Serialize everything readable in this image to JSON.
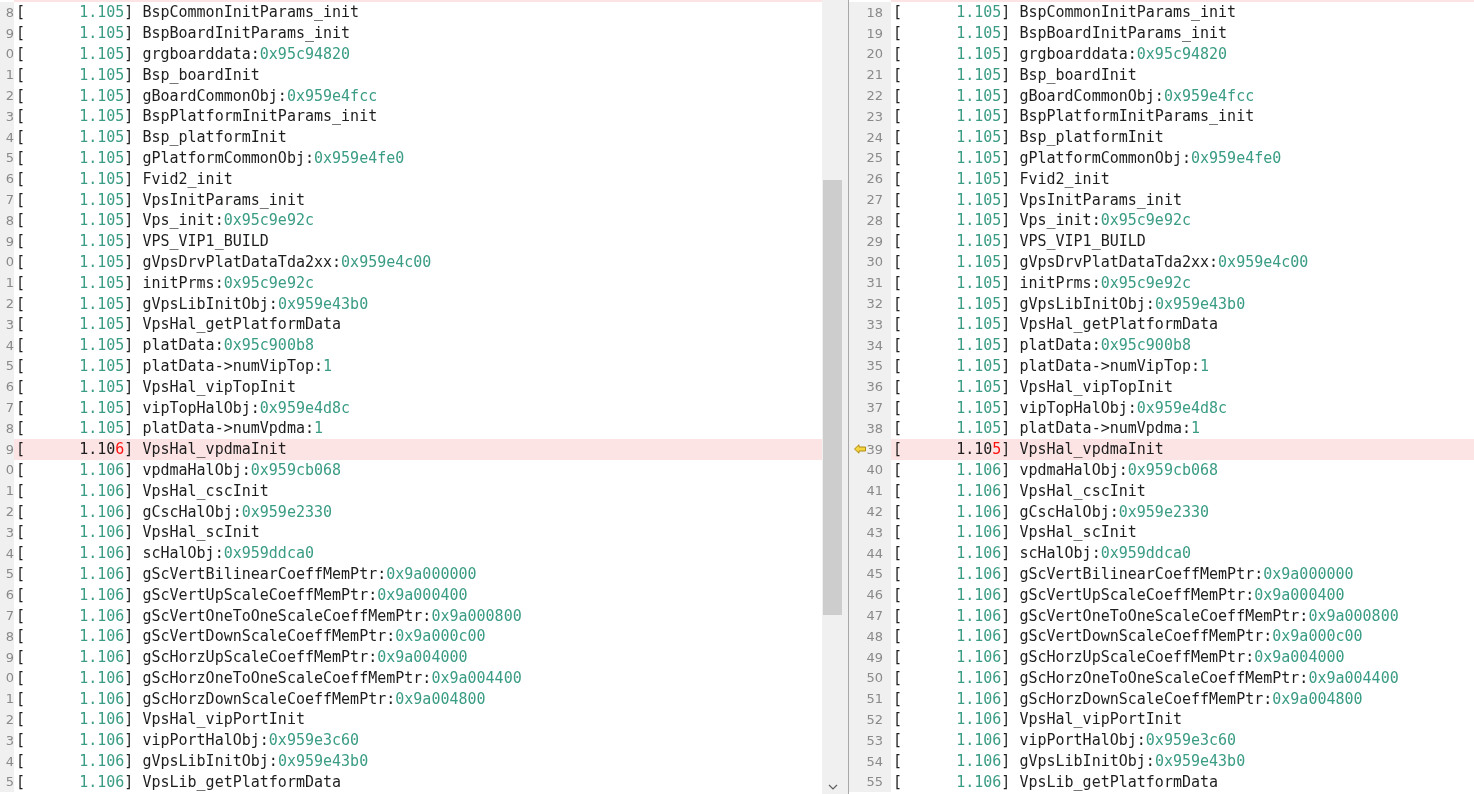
{
  "panes": [
    {
      "kind": "left",
      "above_diff": true,
      "rows": [
        {
          "num": "8",
          "open": "[",
          "time": "1.105",
          "close": "]",
          "text": "BspCommonInitParams_init",
          "diff": false
        },
        {
          "num": "9",
          "open": "[",
          "time": "1.105",
          "close": "]",
          "text": "BspBoardInitParams_init",
          "diff": false
        },
        {
          "num": "0",
          "open": "[",
          "time": "1.105",
          "close": "]",
          "text": "grgboarddata:",
          "value": "0x95c94820",
          "diff": false
        },
        {
          "num": "1",
          "open": "[",
          "time": "1.105",
          "close": "]",
          "text": "Bsp_boardInit",
          "diff": false
        },
        {
          "num": "2",
          "open": "[",
          "time": "1.105",
          "close": "]",
          "text": "gBoardCommonObj:",
          "value": "0x959e4fcc",
          "diff": false
        },
        {
          "num": "3",
          "open": "[",
          "time": "1.105",
          "close": "]",
          "text": "BspPlatformInitParams_init",
          "diff": false
        },
        {
          "num": "4",
          "open": "[",
          "time": "1.105",
          "close": "]",
          "text": "Bsp_platformInit",
          "diff": false
        },
        {
          "num": "5",
          "open": "[",
          "time": "1.105",
          "close": "]",
          "text": "gPlatformCommonObj:",
          "value": "0x959e4fe0",
          "diff": false
        },
        {
          "num": "6",
          "open": "[",
          "time": "1.105",
          "close": "]",
          "text": "Fvid2_init",
          "diff": false
        },
        {
          "num": "7",
          "open": "[",
          "time": "1.105",
          "close": "]",
          "text": "VpsInitParams_init",
          "diff": false
        },
        {
          "num": "8",
          "open": "[",
          "time": "1.105",
          "close": "]",
          "text": "Vps_init:",
          "value": "0x95c9e92c",
          "diff": false
        },
        {
          "num": "9",
          "open": "[",
          "time": "1.105",
          "close": "]",
          "text": "VPS_VIP1_BUILD",
          "diff": false
        },
        {
          "num": "0",
          "open": "[",
          "time": "1.105",
          "close": "]",
          "text": "gVpsDrvPlatDataTda2xx:",
          "value": "0x959e4c00",
          "diff": false
        },
        {
          "num": "1",
          "open": "[",
          "time": "1.105",
          "close": "]",
          "text": "initPrms:",
          "value": "0x95c9e92c",
          "diff": false
        },
        {
          "num": "2",
          "open": "[",
          "time": "1.105",
          "close": "]",
          "text": "gVpsLibInitObj:",
          "value": "0x959e43b0",
          "diff": false
        },
        {
          "num": "3",
          "open": "[",
          "time": "1.105",
          "close": "]",
          "text": "VpsHal_getPlatformData",
          "diff": false
        },
        {
          "num": "4",
          "open": "[",
          "time": "1.105",
          "close": "]",
          "text": "platData:",
          "value": "0x95c900b8",
          "diff": false
        },
        {
          "num": "5",
          "open": "[",
          "time": "1.105",
          "close": "]",
          "text": "platData->numVipTop:",
          "value": "1",
          "diff": false
        },
        {
          "num": "6",
          "open": "[",
          "time": "1.105",
          "close": "]",
          "text": "VpsHal_vipTopInit",
          "diff": false
        },
        {
          "num": "7",
          "open": "[",
          "time": "1.105",
          "close": "]",
          "text": "vipTopHalObj:",
          "value": "0x959e4d8c",
          "diff": false
        },
        {
          "num": "8",
          "open": "[",
          "time": "1.105",
          "close": "]",
          "text": "platData->numVpdma:",
          "value": "1",
          "diff": false
        },
        {
          "num": "9",
          "open": "[",
          "time": "1.10",
          "diff_char": "6",
          "close": "]",
          "text": "VpsHal_vpdmaInit",
          "diff": true
        },
        {
          "num": "0",
          "open": "[",
          "time": "1.106",
          "close": "]",
          "text": "vpdmaHalObj:",
          "value": "0x959cb068",
          "diff": false
        },
        {
          "num": "1",
          "open": "[",
          "time": "1.106",
          "close": "]",
          "text": "VpsHal_cscInit",
          "diff": false
        },
        {
          "num": "2",
          "open": "[",
          "time": "1.106",
          "close": "]",
          "text": "gCscHalObj:",
          "value": "0x959e2330",
          "diff": false
        },
        {
          "num": "3",
          "open": "[",
          "time": "1.106",
          "close": "]",
          "text": "VpsHal_scInit",
          "diff": false
        },
        {
          "num": "4",
          "open": "[",
          "time": "1.106",
          "close": "]",
          "text": "scHalObj:",
          "value": "0x959ddca0",
          "diff": false
        },
        {
          "num": "5",
          "open": "[",
          "time": "1.106",
          "close": "]",
          "text": "gScVertBilinearCoeffMemPtr:",
          "value": "0x9a000000",
          "diff": false
        },
        {
          "num": "6",
          "open": "[",
          "time": "1.106",
          "close": "]",
          "text": "gScVertUpScaleCoeffMemPtr:",
          "value": "0x9a000400",
          "diff": false
        },
        {
          "num": "7",
          "open": "[",
          "time": "1.106",
          "close": "]",
          "text": "gScVertOneToOneScaleCoeffMemPtr:",
          "value": "0x9a000800",
          "diff": false
        },
        {
          "num": "8",
          "open": "[",
          "time": "1.106",
          "close": "]",
          "text": "gScVertDownScaleCoeffMemPtr:",
          "value": "0x9a000c00",
          "diff": false
        },
        {
          "num": "9",
          "open": "[",
          "time": "1.106",
          "close": "]",
          "text": "gScHorzUpScaleCoeffMemPtr:",
          "value": "0x9a004000",
          "diff": false
        },
        {
          "num": "0",
          "open": "[",
          "time": "1.106",
          "close": "]",
          "text": "gScHorzOneToOneScaleCoeffMemPtr:",
          "value": "0x9a004400",
          "diff": false
        },
        {
          "num": "1",
          "open": "[",
          "time": "1.106",
          "close": "]",
          "text": "gScHorzDownScaleCoeffMemPtr:",
          "value": "0x9a004800",
          "diff": false
        },
        {
          "num": "2",
          "open": "[",
          "time": "1.106",
          "close": "]",
          "text": "VpsHal_vipPortInit",
          "diff": false
        },
        {
          "num": "3",
          "open": "[",
          "time": "1.106",
          "close": "]",
          "text": "vipPortHalObj:",
          "value": "0x959e3c60",
          "diff": false
        },
        {
          "num": "4",
          "open": "[",
          "time": "1.106",
          "close": "]",
          "text": "gVpsLibInitObj:",
          "value": "0x959e43b0",
          "diff": false
        },
        {
          "num": "5",
          "open": "[",
          "time": "1.106",
          "close": "]",
          "text": "VpsLib_getPlatformData",
          "diff": false
        }
      ]
    },
    {
      "kind": "right",
      "above_diff": true,
      "rows": [
        {
          "num": "18",
          "open": "[",
          "time": "1.105",
          "close": "]",
          "text": "BspCommonInitParams_init",
          "diff": false,
          "marker": false
        },
        {
          "num": "19",
          "open": "[",
          "time": "1.105",
          "close": "]",
          "text": "BspBoardInitParams_init",
          "diff": false,
          "marker": false
        },
        {
          "num": "20",
          "open": "[",
          "time": "1.105",
          "close": "]",
          "text": "grgboarddata:",
          "value": "0x95c94820",
          "diff": false,
          "marker": false
        },
        {
          "num": "21",
          "open": "[",
          "time": "1.105",
          "close": "]",
          "text": "Bsp_boardInit",
          "diff": false,
          "marker": false
        },
        {
          "num": "22",
          "open": "[",
          "time": "1.105",
          "close": "]",
          "text": "gBoardCommonObj:",
          "value": "0x959e4fcc",
          "diff": false,
          "marker": false
        },
        {
          "num": "23",
          "open": "[",
          "time": "1.105",
          "close": "]",
          "text": "BspPlatformInitParams_init",
          "diff": false,
          "marker": false
        },
        {
          "num": "24",
          "open": "[",
          "time": "1.105",
          "close": "]",
          "text": "Bsp_platformInit",
          "diff": false,
          "marker": false
        },
        {
          "num": "25",
          "open": "[",
          "time": "1.105",
          "close": "]",
          "text": "gPlatformCommonObj:",
          "value": "0x959e4fe0",
          "diff": false,
          "marker": false
        },
        {
          "num": "26",
          "open": "[",
          "time": "1.105",
          "close": "]",
          "text": "Fvid2_init",
          "diff": false,
          "marker": false
        },
        {
          "num": "27",
          "open": "[",
          "time": "1.105",
          "close": "]",
          "text": "VpsInitParams_init",
          "diff": false,
          "marker": false
        },
        {
          "num": "28",
          "open": "[",
          "time": "1.105",
          "close": "]",
          "text": "Vps_init:",
          "value": "0x95c9e92c",
          "diff": false,
          "marker": false
        },
        {
          "num": "29",
          "open": "[",
          "time": "1.105",
          "close": "]",
          "text": "VPS_VIP1_BUILD",
          "diff": false,
          "marker": false
        },
        {
          "num": "30",
          "open": "[",
          "time": "1.105",
          "close": "]",
          "text": "gVpsDrvPlatDataTda2xx:",
          "value": "0x959e4c00",
          "diff": false,
          "marker": false
        },
        {
          "num": "31",
          "open": "[",
          "time": "1.105",
          "close": "]",
          "text": "initPrms:",
          "value": "0x95c9e92c",
          "diff": false,
          "marker": false
        },
        {
          "num": "32",
          "open": "[",
          "time": "1.105",
          "close": "]",
          "text": "gVpsLibInitObj:",
          "value": "0x959e43b0",
          "diff": false,
          "marker": false
        },
        {
          "num": "33",
          "open": "[",
          "time": "1.105",
          "close": "]",
          "text": "VpsHal_getPlatformData",
          "diff": false,
          "marker": false
        },
        {
          "num": "34",
          "open": "[",
          "time": "1.105",
          "close": "]",
          "text": "platData:",
          "value": "0x95c900b8",
          "diff": false,
          "marker": false
        },
        {
          "num": "35",
          "open": "[",
          "time": "1.105",
          "close": "]",
          "text": "platData->numVipTop:",
          "value": "1",
          "diff": false,
          "marker": false
        },
        {
          "num": "36",
          "open": "[",
          "time": "1.105",
          "close": "]",
          "text": "VpsHal_vipTopInit",
          "diff": false,
          "marker": false
        },
        {
          "num": "37",
          "open": "[",
          "time": "1.105",
          "close": "]",
          "text": "vipTopHalObj:",
          "value": "0x959e4d8c",
          "diff": false,
          "marker": false
        },
        {
          "num": "38",
          "open": "[",
          "time": "1.105",
          "close": "]",
          "text": "platData->numVpdma:",
          "value": "1",
          "diff": false,
          "marker": false
        },
        {
          "num": "39",
          "open": "[",
          "time": "1.10",
          "diff_char": "5",
          "close": "]",
          "text": "VpsHal_vpdmaInit",
          "diff": true,
          "marker": true
        },
        {
          "num": "40",
          "open": "[",
          "time": "1.106",
          "close": "]",
          "text": "vpdmaHalObj:",
          "value": "0x959cb068",
          "diff": false,
          "marker": false
        },
        {
          "num": "41",
          "open": "[",
          "time": "1.106",
          "close": "]",
          "text": "VpsHal_cscInit",
          "diff": false,
          "marker": false
        },
        {
          "num": "42",
          "open": "[",
          "time": "1.106",
          "close": "]",
          "text": "gCscHalObj:",
          "value": "0x959e2330",
          "diff": false,
          "marker": false
        },
        {
          "num": "43",
          "open": "[",
          "time": "1.106",
          "close": "]",
          "text": "VpsHal_scInit",
          "diff": false,
          "marker": false
        },
        {
          "num": "44",
          "open": "[",
          "time": "1.106",
          "close": "]",
          "text": "scHalObj:",
          "value": "0x959ddca0",
          "diff": false,
          "marker": false
        },
        {
          "num": "45",
          "open": "[",
          "time": "1.106",
          "close": "]",
          "text": "gScVertBilinearCoeffMemPtr:",
          "value": "0x9a000000",
          "diff": false,
          "marker": false
        },
        {
          "num": "46",
          "open": "[",
          "time": "1.106",
          "close": "]",
          "text": "gScVertUpScaleCoeffMemPtr:",
          "value": "0x9a000400",
          "diff": false,
          "marker": false
        },
        {
          "num": "47",
          "open": "[",
          "time": "1.106",
          "close": "]",
          "text": "gScVertOneToOneScaleCoeffMemPtr:",
          "value": "0x9a000800",
          "diff": false,
          "marker": false
        },
        {
          "num": "48",
          "open": "[",
          "time": "1.106",
          "close": "]",
          "text": "gScVertDownScaleCoeffMemPtr:",
          "value": "0x9a000c00",
          "diff": false,
          "marker": false
        },
        {
          "num": "49",
          "open": "[",
          "time": "1.106",
          "close": "]",
          "text": "gScHorzUpScaleCoeffMemPtr:",
          "value": "0x9a004000",
          "diff": false,
          "marker": false
        },
        {
          "num": "50",
          "open": "[",
          "time": "1.106",
          "close": "]",
          "text": "gScHorzOneToOneScaleCoeffMemPtr:",
          "value": "0x9a004400",
          "diff": false,
          "marker": false
        },
        {
          "num": "51",
          "open": "[",
          "time": "1.106",
          "close": "]",
          "text": "gScHorzDownScaleCoeffMemPtr:",
          "value": "0x9a004800",
          "diff": false,
          "marker": false
        },
        {
          "num": "52",
          "open": "[",
          "time": "1.106",
          "close": "]",
          "text": "VpsHal_vipPortInit",
          "diff": false,
          "marker": false
        },
        {
          "num": "53",
          "open": "[",
          "time": "1.106",
          "close": "]",
          "text": "vipPortHalObj:",
          "value": "0x959e3c60",
          "diff": false,
          "marker": false
        },
        {
          "num": "54",
          "open": "[",
          "time": "1.106",
          "close": "]",
          "text": "gVpsLibInitObj:",
          "value": "0x959e43b0",
          "diff": false,
          "marker": false
        },
        {
          "num": "55",
          "open": "[",
          "time": "1.106",
          "close": "]",
          "text": "VpsLib_getPlatformData",
          "diff": false,
          "marker": false
        }
      ]
    }
  ]
}
